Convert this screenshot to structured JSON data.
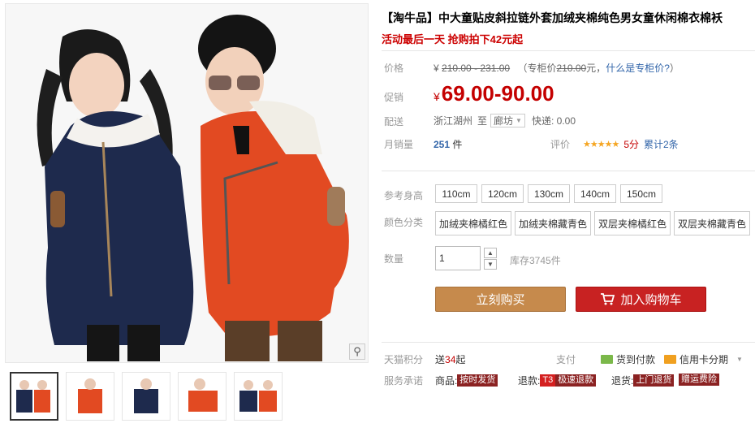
{
  "product": {
    "title": "【淘牛品】中大童贴皮斜拉链外套加绒夹棉纯色男女童休闲棉衣棉袄",
    "promo": "活动最后一天 抢购拍下42元起"
  },
  "price": {
    "label": "价格",
    "yen": "¥",
    "original": "210.00 - 231.00",
    "counter_prefix": "（专柜价",
    "counter_value": "210.00",
    "counter_suffix": "元，",
    "counter_link": "什么是专柜价?",
    "counter_close": "）"
  },
  "promo_price": {
    "label": "促销",
    "yen": "¥",
    "value": "69.00-90.00"
  },
  "shipping": {
    "label": "配送",
    "from": "浙江湖州",
    "to_word": "至",
    "city": "廊坊",
    "delivery": "快递: 0.00"
  },
  "sales": {
    "label": "月销量",
    "count": "251",
    "unit": " 件",
    "rating_label": "评价",
    "stars": "★★★★★",
    "score": "5分",
    "reviews": "累计2条"
  },
  "height": {
    "label": "参考身高",
    "options": [
      "110cm",
      "120cm",
      "130cm",
      "140cm",
      "150cm"
    ]
  },
  "color": {
    "label": "颜色分类",
    "options": [
      "加绒夹棉橘红色",
      "加绒夹棉藏青色",
      "双层夹棉橘红色",
      "双层夹棉藏青色"
    ]
  },
  "quantity": {
    "label": "数量",
    "value": "1",
    "stock": "库存3745件"
  },
  "actions": {
    "buy": "立刻购买",
    "cart": "加入购物车"
  },
  "points": {
    "label": "天猫积分",
    "value_prefix": "送",
    "value": "34",
    "value_suffix": "起",
    "pay_label": "支付",
    "cod": "货到付款",
    "credit": "信用卡分期"
  },
  "service": {
    "label": "服务承诺",
    "goods": "商品:",
    "goods_tag": "按时发货",
    "return": "退款:",
    "t3": "T3",
    "return_tag": "极速退款",
    "refund": "退货:",
    "refund_tag": "上门退货",
    "insurance_tag": "赠运费险"
  },
  "colors": {
    "price_red": "#c40000",
    "buy_button": "#c68a4c",
    "cart_button": "#c82222",
    "link_blue": "#3366aa",
    "star": "#f5a623"
  }
}
